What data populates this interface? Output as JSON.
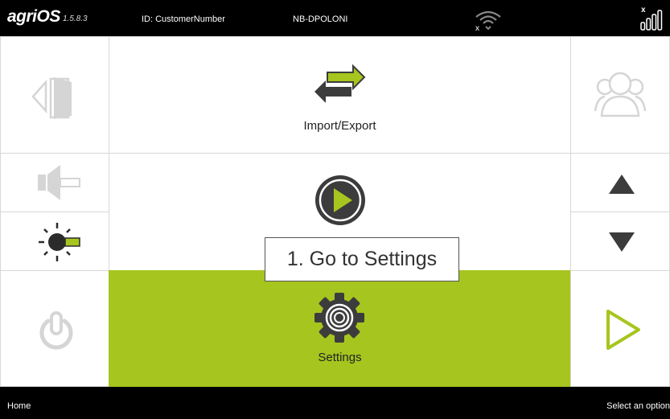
{
  "header": {
    "brand": "agriOS",
    "version": "1.5.8.3",
    "customer_id": "ID: CustomerNumber",
    "device_name": "NB-DPOLONI"
  },
  "menu": {
    "items": [
      {
        "label": "Import/Export",
        "icon": "import-export-icon"
      },
      {
        "label": "",
        "icon": "play-icon"
      },
      {
        "label": "Settings",
        "icon": "gear-icon",
        "selected": true
      }
    ]
  },
  "sidebar_left": {
    "icons": [
      "logout-icon",
      "volume-icon",
      "brightness-icon",
      "power-icon"
    ]
  },
  "sidebar_right": {
    "icons": [
      "users-icon",
      "arrow-up-icon",
      "arrow-down-icon",
      "next-icon"
    ]
  },
  "callout": {
    "text": "1. Go to Settings"
  },
  "status": {
    "left": "Home",
    "right": "Select an option"
  },
  "colors": {
    "accent": "#a6c51f",
    "dark": "#3c3c3c",
    "disabled": "#d5d5d5"
  }
}
